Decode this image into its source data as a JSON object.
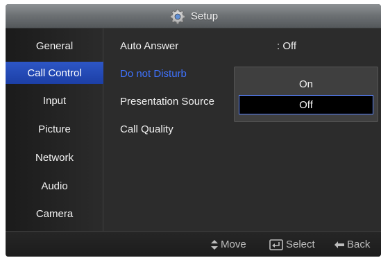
{
  "header": {
    "title": "Setup",
    "icon": "gear-icon"
  },
  "sidebar": {
    "items": [
      {
        "label": "General"
      },
      {
        "label": "Call Control"
      },
      {
        "label": "Input"
      },
      {
        "label": "Picture"
      },
      {
        "label": "Network"
      },
      {
        "label": "Audio"
      },
      {
        "label": "Camera"
      }
    ],
    "active_index": 1
  },
  "main": {
    "rows": [
      {
        "label": "Auto Answer",
        "value": ": Off"
      },
      {
        "label": "Do not Disturb",
        "value": ""
      },
      {
        "label": "Presentation Source",
        "value": ""
      },
      {
        "label": "Call Quality",
        "value": ""
      }
    ]
  },
  "dropdown": {
    "options": [
      {
        "label": "On"
      },
      {
        "label": "Off"
      }
    ],
    "selected": "Off"
  },
  "footer": {
    "move": {
      "label": "Move",
      "icon": "up-down-arrows-icon"
    },
    "select": {
      "label": "Select",
      "icon": "enter-icon"
    },
    "back": {
      "label": "Back",
      "icon": "back-arrow-icon"
    }
  },
  "colors": {
    "active_bg": "#2546b8",
    "highlight_text": "#3f73ff",
    "selected_border": "#5d87ff"
  }
}
